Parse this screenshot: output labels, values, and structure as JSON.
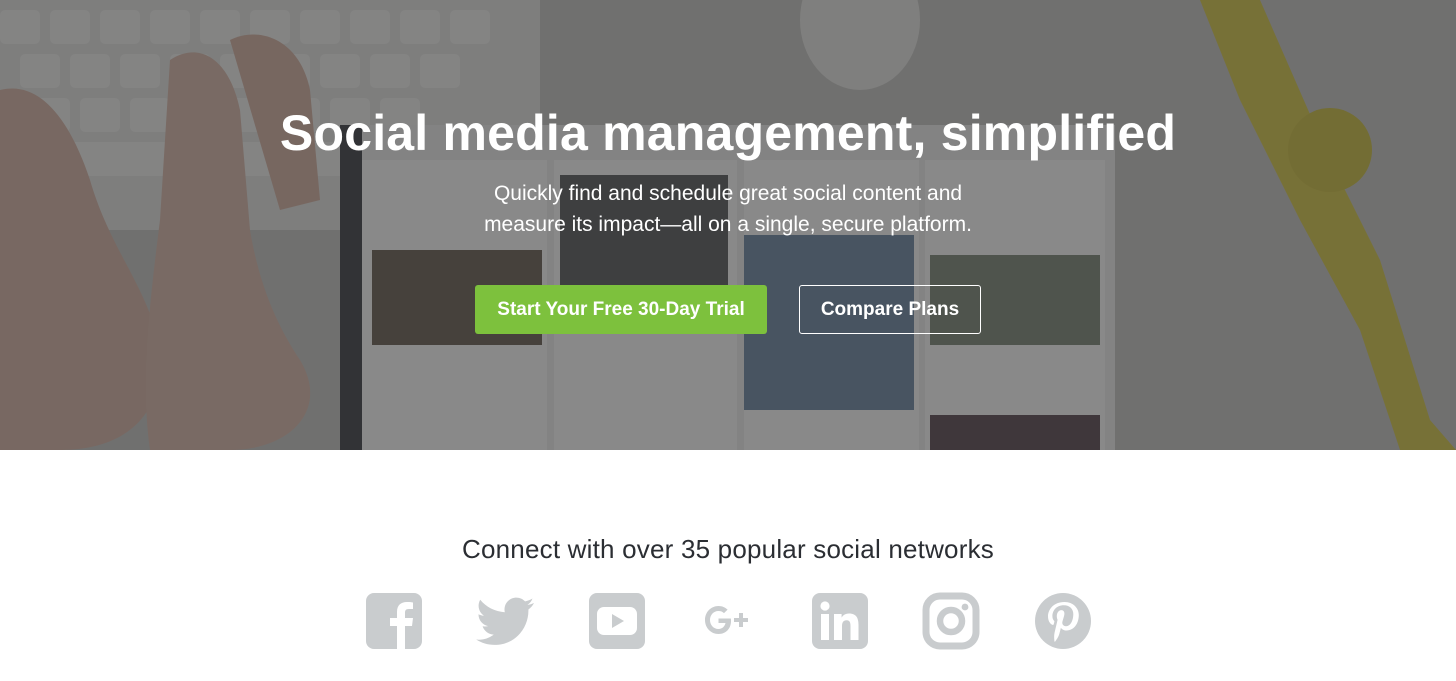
{
  "hero": {
    "title": "Social media management, simplified",
    "subtitle_line1": "Quickly find and schedule great social content and",
    "subtitle_line2": "measure its impact—all on a single, secure platform.",
    "primary_cta": "Start Your Free 30-Day Trial",
    "secondary_cta": "Compare Plans"
  },
  "networks": {
    "heading": "Connect with over 35 popular social networks",
    "icons": [
      "facebook-icon",
      "twitter-icon",
      "youtube-icon",
      "google-plus-icon",
      "linkedin-icon",
      "instagram-icon",
      "pinterest-icon"
    ]
  },
  "colors": {
    "accent_green": "#7dc13d",
    "icon_gray": "#c9ccce",
    "heading_text": "#2b2e33"
  }
}
